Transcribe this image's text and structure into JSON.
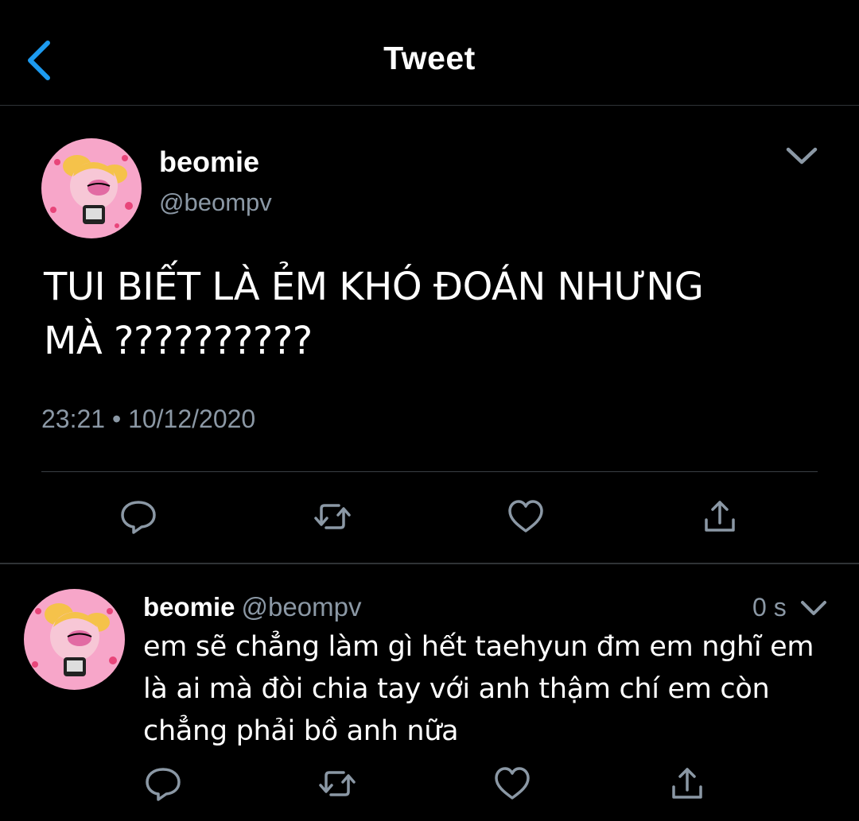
{
  "header": {
    "title": "Tweet",
    "back_icon": "chevron-left-icon"
  },
  "colors": {
    "background": "#000000",
    "text_primary": "#ffffff",
    "text_secondary": "#8b98a5",
    "accent": "#1d9bf0",
    "divider": "#2f3336"
  },
  "main_tweet": {
    "display_name": "beomie",
    "handle": "@beompv",
    "text": "TUI BIẾT LÀ ẺM KHÓ ĐOÁN NHƯNG MÀ ??????????",
    "timestamp": "23:21 • 10/12/2020",
    "actions": [
      "reply-icon",
      "retweet-icon",
      "like-icon",
      "share-icon"
    ]
  },
  "reply_tweet": {
    "display_name": "beomie",
    "handle": "@beompv",
    "time": "0 s",
    "text": "em sẽ chẳng làm gì hết taehyun đm em nghĩ em là ai mà đòi chia tay với anh thậm chí em còn chẳng phải bồ anh nữa",
    "actions": [
      "reply-icon",
      "retweet-icon",
      "like-icon",
      "share-icon"
    ]
  }
}
